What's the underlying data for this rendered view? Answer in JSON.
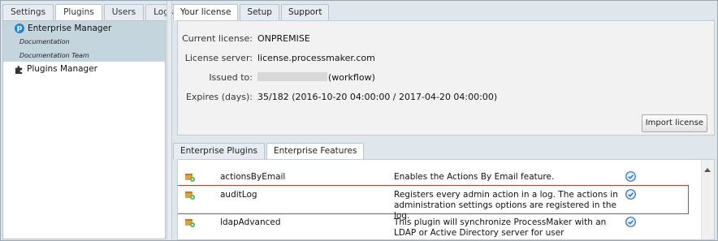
{
  "left_tabs": [
    "Settings",
    "Plugins",
    "Users",
    "Logs"
  ],
  "tree": {
    "enterprise_manager": "Enterprise Manager",
    "children": [
      "Documentation",
      "Documentation Team"
    ],
    "plugins_manager": "Plugins Manager"
  },
  "license_tabs": [
    "Your license",
    "Setup",
    "Support"
  ],
  "license": {
    "rows": [
      {
        "label": "Current license:",
        "value": "ONPREMISE"
      },
      {
        "label": "License server:",
        "value": "license.processmaker.com"
      },
      {
        "label": "Issued to:",
        "value": "(workflow)"
      },
      {
        "label": "Expires (days):",
        "value": "35/182 (2016-10-20 04:00:00 / 2017-04-20 04:00:00)"
      }
    ],
    "import_button": "Import license"
  },
  "bottom_tabs": [
    "Enterprise Plugins",
    "Enterprise Features"
  ],
  "features": [
    {
      "name": "actionsByEmail",
      "desc": "Enables the Actions By Email feature.",
      "enabled": true
    },
    {
      "name": "auditLog",
      "desc": "Registers every admin action in a log. The actions in administration settings options are registered in the log.",
      "enabled": true
    },
    {
      "name": "ldapAdvanced",
      "desc": "This plugin will synchronize ProcessMaker with an LDAP or Active Directory server for user authentication.",
      "enabled": true
    }
  ],
  "icons": {
    "plugin": "plugin-package-icon",
    "check": "check-circle-icon",
    "logo": "processmaker-logo-icon",
    "puzzle": "puzzle-icon"
  },
  "colors": {
    "selection": "#c4d5de",
    "highlight_border": "#d33b3b",
    "check_blue": "#2a6fc4"
  }
}
